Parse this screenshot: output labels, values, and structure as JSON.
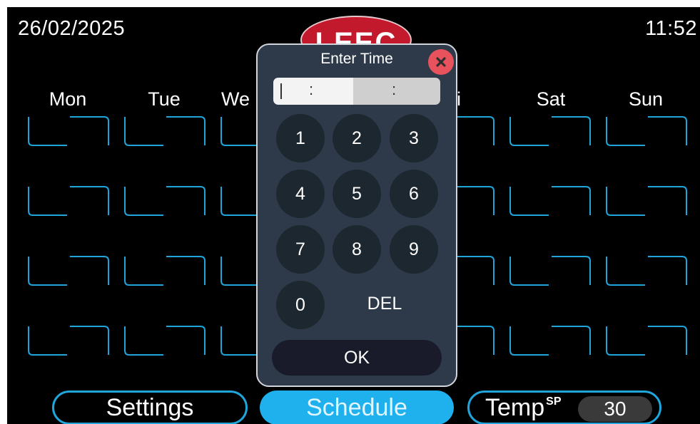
{
  "status_bar": {
    "date": "26/02/2025",
    "time": "11:52"
  },
  "logo": {
    "text": "LEEC",
    "color": "#c2192c"
  },
  "schedule": {
    "days": [
      "Mon",
      "Tue",
      "We",
      "i",
      "Sat",
      "Sun"
    ],
    "slot_color": "#1fa5da",
    "rows": 4
  },
  "bottom_nav": {
    "settings_label": "Settings",
    "schedule_label": "Schedule",
    "temp_label": "Temp",
    "temp_superscript": "SP",
    "temp_value": "30",
    "active_tab": "Schedule"
  },
  "time_dialog": {
    "title": "Enter Time",
    "hour_value": "",
    "minute_value": "",
    "separator": ":",
    "keys": [
      "1",
      "2",
      "3",
      "4",
      "5",
      "6",
      "7",
      "8",
      "9",
      "0"
    ],
    "delete_label": "DEL",
    "ok_label": "OK"
  },
  "icons": {
    "close": "close-icon"
  },
  "colors": {
    "accent": "#1fa5da",
    "active_button": "#1fb1ee",
    "dialog_bg": "#2e3a4a",
    "close_button": "#e8525d"
  }
}
